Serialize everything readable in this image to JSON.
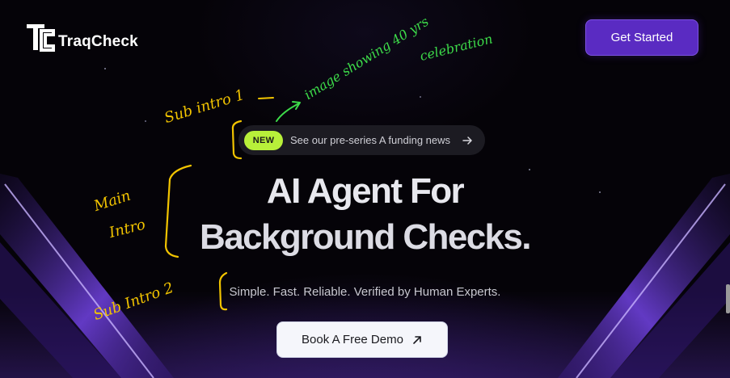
{
  "header": {
    "brand_name": "TraqCheck",
    "logo_mark": "TC",
    "cta_label": "Get Started"
  },
  "announcement": {
    "badge": "NEW",
    "text": "See our pre-series A funding news",
    "icon": "arrow-right-icon"
  },
  "hero": {
    "line1": "AI Agent For",
    "line2": "Background Checks.",
    "subtitle": "Simple. Fast. Reliable. Verified by Human Experts."
  },
  "demo_button": {
    "label": "Book A Free Demo",
    "icon": "arrow-up-right-icon"
  },
  "annotations": {
    "green_line1": "image showing 40 yrs",
    "green_line2": "celebration",
    "sub_intro_1": "Sub intro 1",
    "main_intro_line1": "Main",
    "main_intro_line2": "Intro",
    "sub_intro_2": "Sub Intro 2"
  },
  "colors": {
    "background": "#050308",
    "accent_purple": "#5a2bc2",
    "badge_green": "#b8f03a",
    "annotation_green": "#3ddc4a",
    "annotation_yellow": "#f2c400"
  }
}
